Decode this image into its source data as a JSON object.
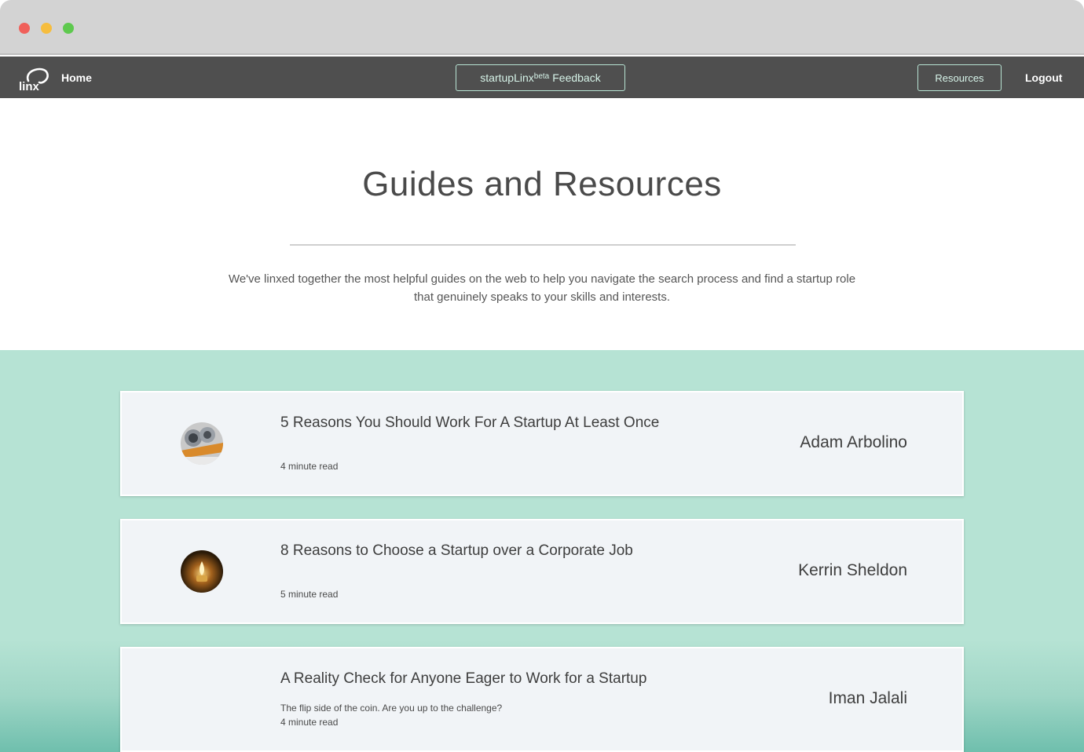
{
  "nav": {
    "home_label": "Home",
    "feedback_label_main": "startupLinx",
    "feedback_label_sup": "beta",
    "feedback_label_end": "Feedback",
    "resources_label": "Resources",
    "logout_label": "Logout",
    "logo_icon": "linx-logo-icon"
  },
  "hero": {
    "title": "Guides and Resources",
    "intro": "We've linxed together the most helpful guides on the web to help you navigate the search process and find a startup role that genuinely speaks to your skills and interests."
  },
  "resources": [
    {
      "title": "5 Reasons You Should Work For A Startup At Least Once",
      "subtitle": "",
      "read_time": "4 minute read",
      "author": "Adam Arbolino",
      "thumb_icon": "pipes-thumbnail"
    },
    {
      "title": "8 Reasons to Choose a Startup over a Corporate Job",
      "subtitle": "",
      "read_time": "5 minute read",
      "author": "Kerrin Sheldon",
      "thumb_icon": "candle-thumbnail"
    },
    {
      "title": "A Reality Check for Anyone Eager to Work for a Startup",
      "subtitle": "The flip side of the coin. Are you up to the challenge?",
      "read_time": "4 minute read",
      "author": "Iman Jalali",
      "thumb_icon": ""
    }
  ],
  "colors": {
    "navbar": "#4f4f4f",
    "accent_border": "#b7e3d3",
    "section_bg": "#b6e3d4",
    "card_bg": "#f1f4f7"
  }
}
